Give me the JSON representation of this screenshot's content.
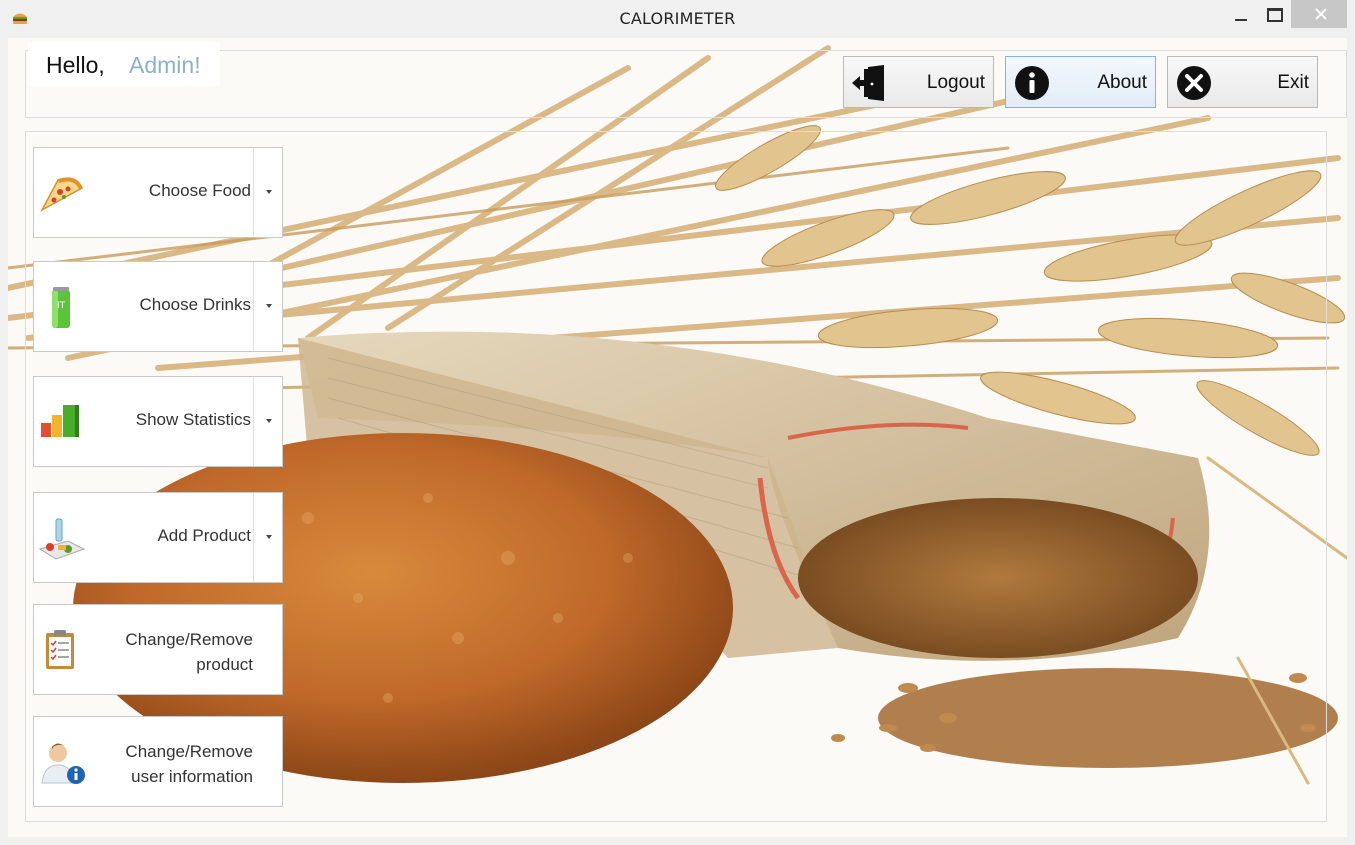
{
  "window": {
    "title": "CALORIMETER",
    "icons": {
      "app": "hamburger-icon",
      "minimize": "minimize-icon",
      "maximize": "maximize-icon",
      "close": "close-icon"
    }
  },
  "header": {
    "greeting": "Hello,",
    "username": "Admin!",
    "username_color": "#8eb0cc"
  },
  "actions": [
    {
      "label": "Logout",
      "icon": "door-exit-icon"
    },
    {
      "label": "About",
      "icon": "info-icon"
    },
    {
      "label": "Exit",
      "icon": "close-circle-icon"
    }
  ],
  "menu": [
    {
      "label": "Choose Food",
      "icon": "pizza-slice-icon",
      "dropdown": true
    },
    {
      "label": "Choose Drinks",
      "icon": "soda-can-icon",
      "dropdown": true
    },
    {
      "label": "Show Statistics",
      "icon": "bar-chart-icon",
      "dropdown": true
    },
    {
      "label": "Add Product",
      "icon": "groceries-icon",
      "dropdown": true
    },
    {
      "label_line1": "Change/Remove",
      "label_line2": "product",
      "icon": "clipboard-checklist-icon",
      "dropdown": false
    },
    {
      "label_line1": "Change/Remove",
      "label_line2": "user information",
      "icon": "user-info-icon",
      "dropdown": false
    }
  ],
  "background": {
    "image": "bread-and-wheat-photo"
  }
}
